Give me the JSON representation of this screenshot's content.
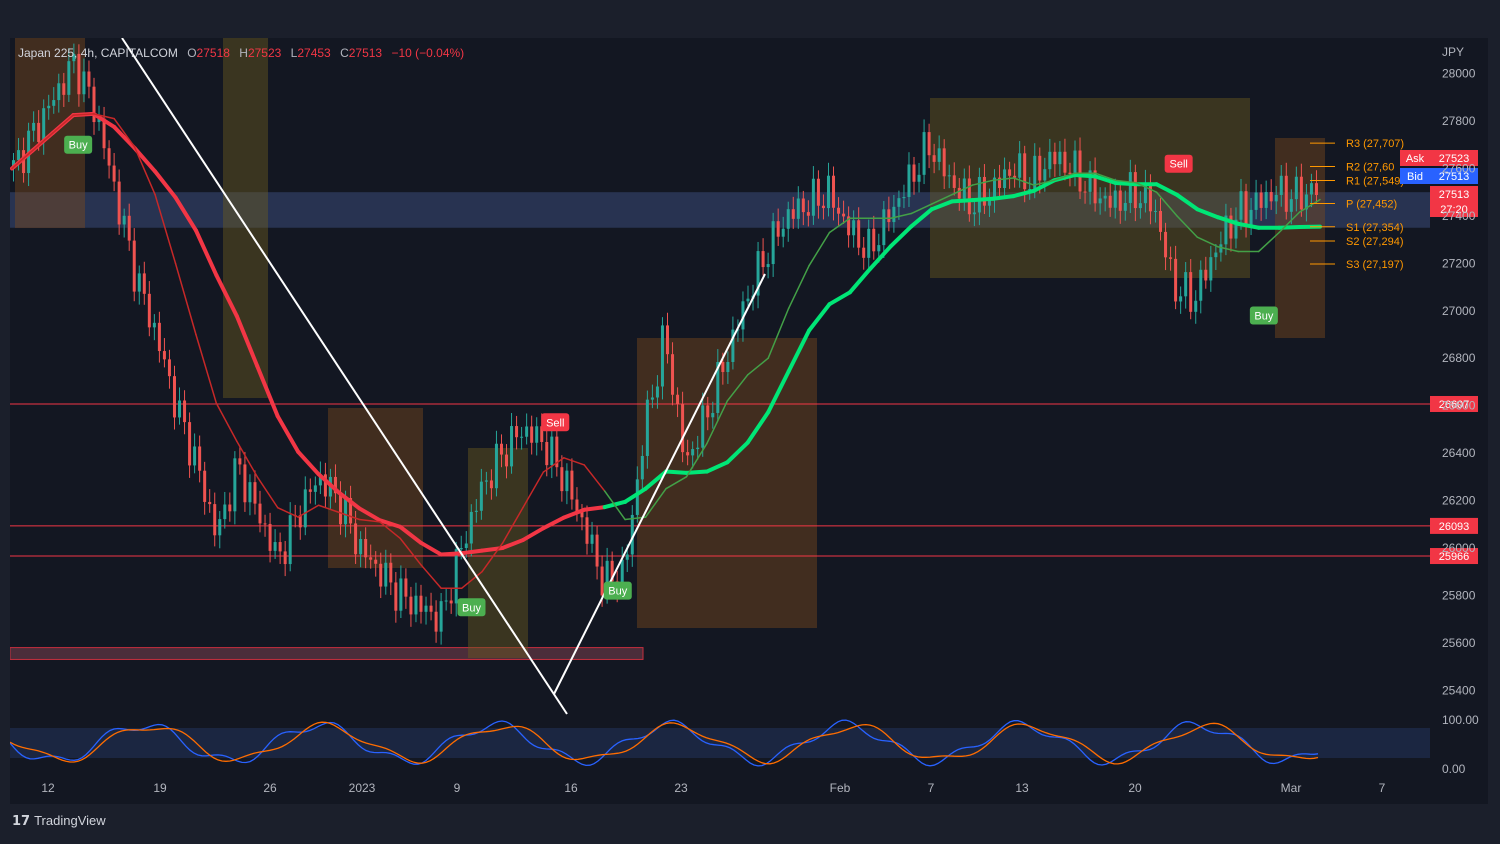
{
  "header": {
    "symbol": "Japan 225, 4h, CAPITALCOM",
    "o_label": "O",
    "o": "27518",
    "h_label": "H",
    "h": "27523",
    "l_label": "L",
    "l": "27453",
    "c_label": "C",
    "c": "27513",
    "change": "−10 (−0.04%)"
  },
  "brand": "TradingView",
  "chart_data": {
    "type": "candlestick",
    "currency": "JPY",
    "y_ticks": [
      "28000",
      "27800",
      "27600",
      "27400",
      "27200",
      "27000",
      "26800",
      "26600",
      "26400",
      "26200",
      "26000",
      "25800",
      "25600",
      "25400"
    ],
    "x_ticks": [
      "12",
      "19",
      "26",
      "2023",
      "9",
      "16",
      "23",
      "Feb",
      "7",
      "13",
      "20",
      "Mar",
      "7"
    ],
    "ylim": [
      25300,
      28150
    ],
    "price_tags": [
      {
        "label": "Ask",
        "value": "27523",
        "color": "#f23645"
      },
      {
        "label": "Bid",
        "value": "27513",
        "color": "#2962ff"
      },
      {
        "label": "",
        "value": "27513",
        "color": "#f23645"
      },
      {
        "label": "",
        "value": "27:20",
        "color": "#f23645"
      }
    ],
    "horizontal_levels": [
      {
        "value": 26607,
        "label": "26607",
        "color": "#f23645"
      },
      {
        "value": 26093,
        "label": "26093",
        "color": "#f23645"
      },
      {
        "value": 25966,
        "label": "25966",
        "color": "#f23645"
      }
    ],
    "pivots": [
      {
        "label": "R3 (27,707)",
        "value": 27707
      },
      {
        "label": "R2 (27,60",
        "value": 27608
      },
      {
        "label": "R1 (27,549)",
        "value": 27549
      },
      {
        "label": "P (27,452)",
        "value": 27452
      },
      {
        "label": "S1 (27,354)",
        "value": 27354
      },
      {
        "label": "S2 (27,294)",
        "value": 27294
      },
      {
        "label": "S3 (27,197)",
        "value": 27197
      }
    ],
    "signals": [
      {
        "label": "Buy",
        "x": 0.048,
        "value": 27700,
        "color": "#4caf50"
      },
      {
        "label": "Sell",
        "x": 0.384,
        "value": 26530,
        "color": "#f23645"
      },
      {
        "label": "Buy",
        "x": 0.325,
        "value": 25750,
        "color": "#4caf50"
      },
      {
        "label": "Buy",
        "x": 0.428,
        "value": 25820,
        "color": "#4caf50"
      },
      {
        "label": "Sell",
        "x": 0.823,
        "value": 27620,
        "color": "#f23645"
      },
      {
        "label": "Buy",
        "x": 0.883,
        "value": 26980,
        "color": "#4caf50"
      }
    ],
    "oscillator": {
      "ticks": [
        "100.00",
        "0.00"
      ]
    },
    "close_series": [
      27600,
      27750,
      27900,
      28050,
      27850,
      27500,
      27150,
      26900,
      26600,
      26350,
      26050,
      26350,
      26150,
      25950,
      26150,
      26300,
      26200,
      26000,
      25900,
      25800,
      25750,
      25700,
      26000,
      26250,
      26400,
      26500,
      26450,
      26300,
      26100,
      25850,
      25900,
      26500,
      26900,
      26350,
      26550,
      26800,
      27050,
      27250,
      27400,
      27450,
      27500,
      27350,
      27250,
      27400,
      27550,
      27700,
      27550,
      27450,
      27500,
      27600,
      27550,
      27650,
      27600,
      27500,
      27450,
      27500,
      27450,
      27100,
      27050,
      27250,
      27400,
      27450,
      27500,
      27480,
      27513
    ]
  }
}
